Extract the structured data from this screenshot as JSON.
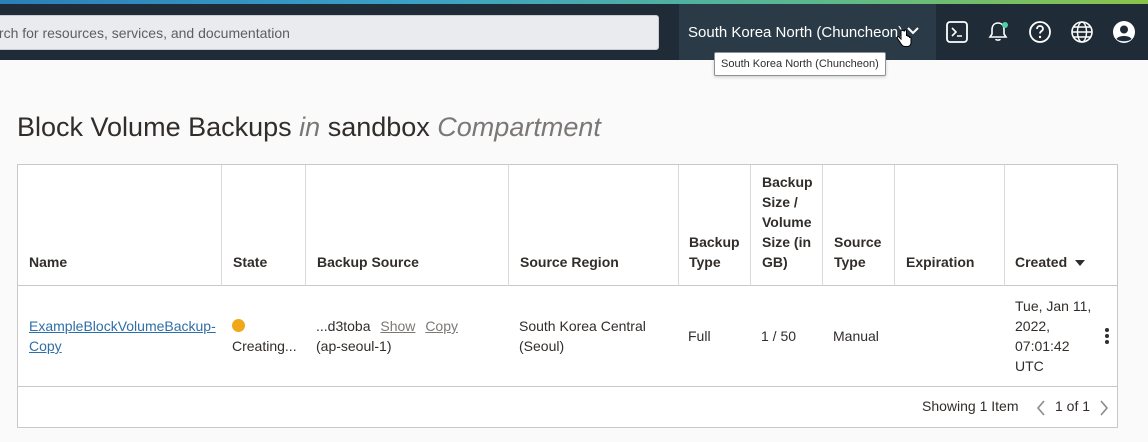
{
  "search": {
    "placeholder": "Search for resources, services, and documentation"
  },
  "region": {
    "label": "South Korea North (Chuncheon)",
    "tooltip": "South Korea North (Chuncheon)"
  },
  "page": {
    "title_main": "Block Volume Backups",
    "title_in": "in",
    "title_compartment": "sandbox",
    "title_suffix": "Compartment"
  },
  "table": {
    "headers": {
      "name": "Name",
      "state": "State",
      "backup_source": "Backup Source",
      "source_region": "Source Region",
      "backup_type": "Backup Type",
      "backup_size": "Backup Size / Volume Size (in GB)",
      "source_type": "Source Type",
      "expiration": "Expiration",
      "created": "Created"
    },
    "rows": [
      {
        "name": "ExampleBlockVolumeBackup-Copy",
        "state": "Creating...",
        "backup_source_id": "...d3toba",
        "show_label": "Show",
        "copy_label": "Copy",
        "backup_source_region": "(ap-seoul-1)",
        "source_region": "South Korea Central (Seoul)",
        "backup_type": "Full",
        "backup_size": "1 / 50",
        "source_type": "Manual",
        "expiration": "",
        "created": "Tue, Jan 11, 2022, 07:01:42 UTC"
      }
    ],
    "showing": "Showing 1 Item",
    "page_label": "1 of 1"
  },
  "colors": {
    "topbar": "#1f2b36",
    "link": "#2e6fa7",
    "state_creating": "#f0a818"
  },
  "icons": [
    "chevron-down-icon",
    "cloud-shell-icon",
    "bell-icon",
    "help-icon",
    "globe-icon",
    "user-icon",
    "kebab-icon",
    "chevron-left-icon",
    "chevron-right-icon"
  ]
}
